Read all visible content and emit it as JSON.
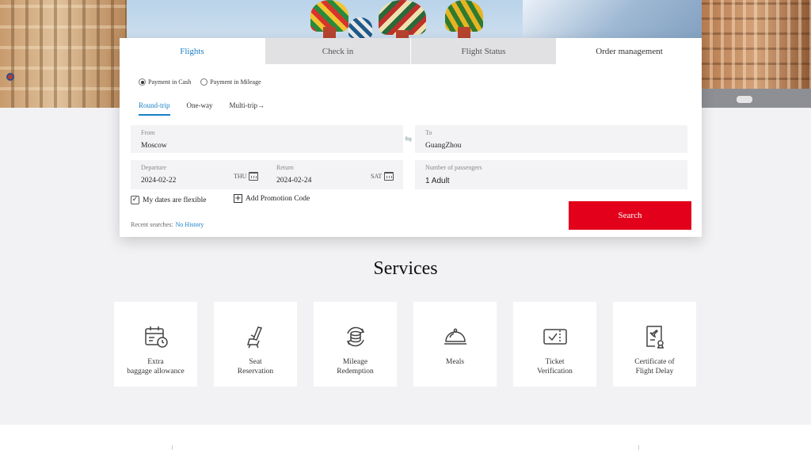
{
  "tabs": [
    {
      "label": "Flights",
      "state": "active"
    },
    {
      "label": "Check in",
      "state": "inactive"
    },
    {
      "label": "Flight Status",
      "state": "inactive"
    },
    {
      "label": "Order management",
      "state": "plain"
    }
  ],
  "payment": {
    "options": [
      {
        "label": "Payment in Cash",
        "selected": true
      },
      {
        "label": "Payment in Mileage",
        "selected": false
      }
    ]
  },
  "trip_types": [
    {
      "label": "Round-trip",
      "selected": true
    },
    {
      "label": "One-way",
      "selected": false
    },
    {
      "label": "Multi-trip→",
      "selected": false
    }
  ],
  "from": {
    "label": "From",
    "value": "Moscow"
  },
  "to": {
    "label": "To",
    "value": "GuangZhou"
  },
  "swap_icon": "⇋",
  "departure": {
    "label": "Departure",
    "value": "2024-02-22",
    "weekday": "THU"
  },
  "return_date": {
    "label": "Return",
    "value": "2024-02-24",
    "weekday": "SAT"
  },
  "passengers": {
    "label": "Number of passengers",
    "value": "1 Adult"
  },
  "flexible": {
    "label": "My dates are flexible",
    "checked": true
  },
  "promo": {
    "label": "Add Promotion Code"
  },
  "recent": {
    "label": "Recent searches:",
    "link": "No History"
  },
  "search_button": "Search",
  "services": {
    "title": "Services",
    "items": [
      {
        "line1": "Extra",
        "line2": "baggage allowance",
        "icon": "baggage-calendar-icon"
      },
      {
        "line1": "Seat",
        "line2": "Reservation",
        "icon": "seat-icon"
      },
      {
        "line1": "Mileage",
        "line2": "Redemption",
        "icon": "coins-cycle-icon"
      },
      {
        "line1": "Meals",
        "line2": "",
        "icon": "cloche-icon"
      },
      {
        "line1": "Ticket",
        "line2": "Verification",
        "icon": "ticket-check-icon"
      },
      {
        "line1": "Certificate of",
        "line2": "Flight Delay",
        "icon": "certificate-icon"
      }
    ]
  },
  "colors": {
    "accent": "#1b7fc7",
    "brand_red": "#e3001b"
  }
}
